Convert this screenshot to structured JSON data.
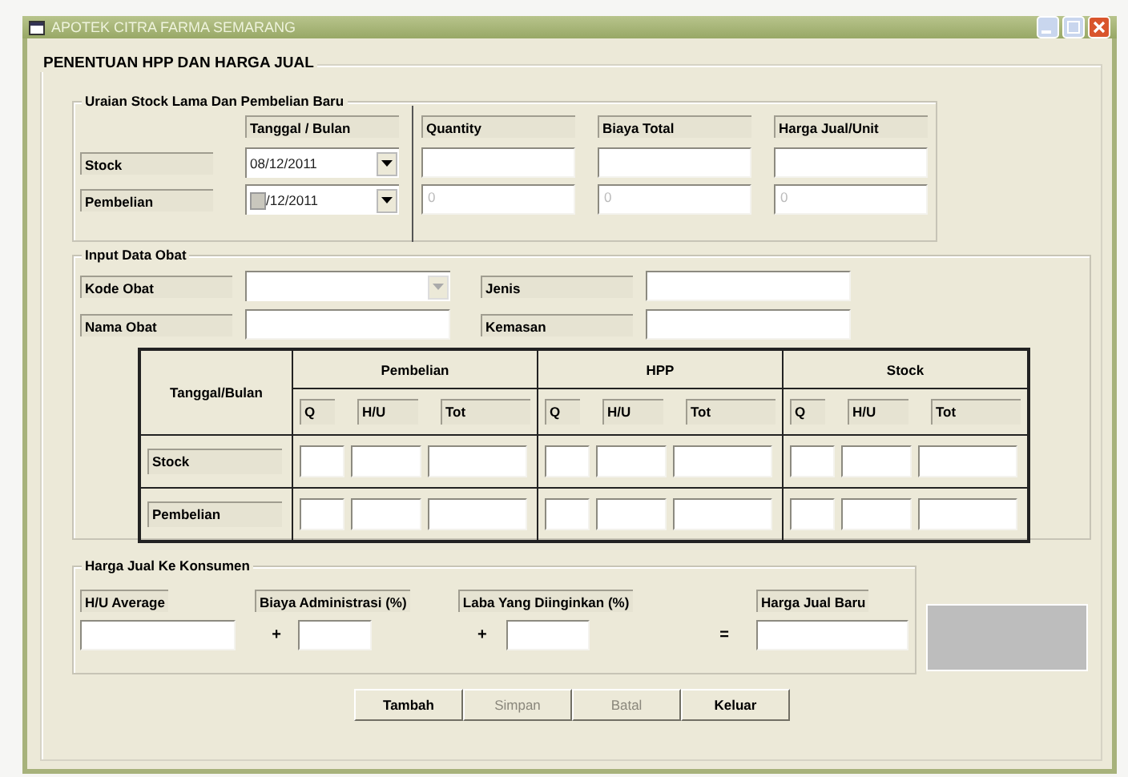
{
  "window": {
    "title": "APOTEK CITRA FARMA SEMARANG"
  },
  "form": {
    "title": "PENENTUAN HPP DAN HARGA JUAL"
  },
  "stock_section": {
    "title": "Uraian Stock Lama Dan Pembelian Baru",
    "columns": [
      "Tanggal / Bulan",
      "Quantity",
      "Biaya Total",
      "Harga Jual/Unit"
    ],
    "rows": [
      {
        "label": "Stock",
        "date": "08/12/2011",
        "day_highlighted": false
      },
      {
        "label": "Pembelian",
        "date": "/12/2011",
        "day_highlighted": true,
        "values": [
          "0",
          "0",
          "0"
        ]
      }
    ]
  },
  "input_section": {
    "title": "Input Data Obat",
    "fields": [
      {
        "label": "Kode Obat",
        "kind": "combo"
      },
      {
        "label": "Jenis",
        "kind": "text"
      },
      {
        "label": "Nama Obat",
        "kind": "text"
      },
      {
        "label": "Kemasan",
        "kind": "text"
      }
    ],
    "table": {
      "corner": "Tanggal/Bulan",
      "groups": [
        {
          "title": "Pembelian",
          "subcolumns": [
            "Q",
            "H/U",
            "Tot"
          ]
        },
        {
          "title": "HPP",
          "subcolumns": [
            "Q",
            "H/U",
            "Tot"
          ]
        },
        {
          "title": "Stock",
          "subcolumns": [
            "Q",
            "H/U",
            "Tot"
          ]
        }
      ],
      "rows": [
        "Stock",
        "Pembelian"
      ]
    }
  },
  "price_section": {
    "title": "Harga Jual Ke Konsumen",
    "items": [
      {
        "label": "H/U Average"
      },
      {
        "operator": "+",
        "label": "Biaya Administrasi (%)"
      },
      {
        "operator": "+",
        "label": "Laba Yang Diinginkan (%)"
      },
      {
        "operator": "=",
        "label": "Harga Jual Baru"
      }
    ]
  },
  "buttons": [
    {
      "label": "Tambah",
      "disabled": false
    },
    {
      "label": "Simpan",
      "disabled": true
    },
    {
      "label": "Batal",
      "disabled": true
    },
    {
      "label": "Keluar",
      "disabled": false
    }
  ]
}
